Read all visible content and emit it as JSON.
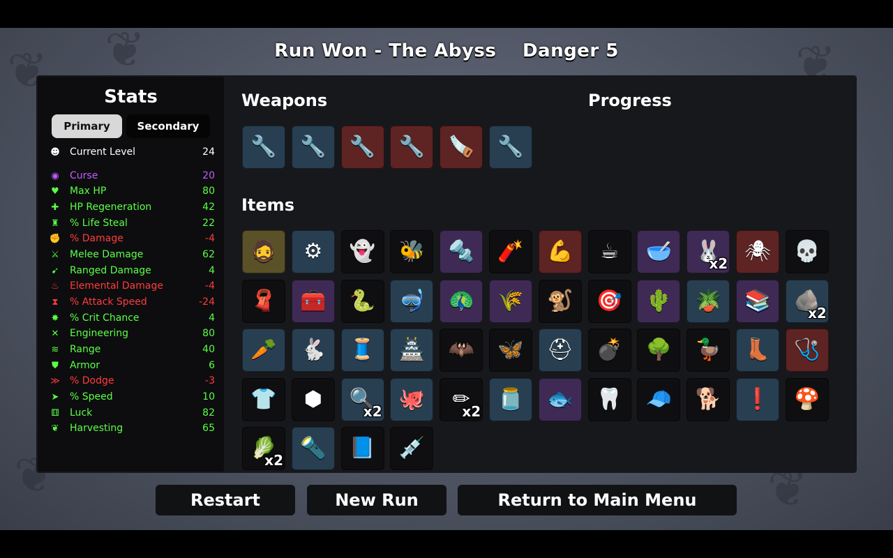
{
  "header": {
    "run_result": "Run Won - The Abyss",
    "danger": "Danger 5"
  },
  "stats": {
    "title": "Stats",
    "tabs": {
      "primary": "Primary",
      "secondary": "Secondary"
    },
    "rows": [
      {
        "label": "Current Level",
        "value": "24",
        "color": "#ffffff",
        "icon": "level-icon"
      },
      {
        "label": "Curse",
        "value": "20",
        "color": "#c35cff",
        "icon": "curse-icon"
      },
      {
        "label": "Max HP",
        "value": "80",
        "color": "#5bff46",
        "icon": "heart-icon"
      },
      {
        "label": "HP Regeneration",
        "value": "42",
        "color": "#5bff46",
        "icon": "regen-icon"
      },
      {
        "label": "% Life Steal",
        "value": "22",
        "color": "#5bff46",
        "icon": "life-steal-icon"
      },
      {
        "label": "% Damage",
        "value": "-4",
        "color": "#ff3c3c",
        "icon": "damage-icon"
      },
      {
        "label": "Melee Damage",
        "value": "62",
        "color": "#5bff46",
        "icon": "melee-icon"
      },
      {
        "label": "Ranged Damage",
        "value": "4",
        "color": "#5bff46",
        "icon": "ranged-icon"
      },
      {
        "label": "Elemental Damage",
        "value": "-4",
        "color": "#ff3c3c",
        "icon": "fire-icon"
      },
      {
        "label": "% Attack Speed",
        "value": "-24",
        "color": "#ff3c3c",
        "icon": "hourglass-icon"
      },
      {
        "label": "% Crit Chance",
        "value": "4",
        "color": "#5bff46",
        "icon": "crit-icon"
      },
      {
        "label": "Engineering",
        "value": "80",
        "color": "#5bff46",
        "icon": "engineering-icon"
      },
      {
        "label": "Range",
        "value": "40",
        "color": "#5bff46",
        "icon": "range-icon"
      },
      {
        "label": "Armor",
        "value": "6",
        "color": "#5bff46",
        "icon": "shield-icon"
      },
      {
        "label": "% Dodge",
        "value": "-3",
        "color": "#ff3c3c",
        "icon": "dodge-icon"
      },
      {
        "label": "% Speed",
        "value": "10",
        "color": "#5bff46",
        "icon": "speed-icon"
      },
      {
        "label": "Luck",
        "value": "82",
        "color": "#5bff46",
        "icon": "dice-icon"
      },
      {
        "label": "Harvesting",
        "value": "65",
        "color": "#5bff46",
        "icon": "harvest-icon"
      }
    ]
  },
  "sections": {
    "weapons": "Weapons",
    "progress": "Progress",
    "items": "Items"
  },
  "weapons": [
    {
      "icon": "wrench-icon",
      "tier": "blue"
    },
    {
      "icon": "wrench-icon",
      "tier": "blue"
    },
    {
      "icon": "wrench-icon",
      "tier": "red"
    },
    {
      "icon": "wrench-icon",
      "tier": "red"
    },
    {
      "icon": "chainsaw-icon",
      "tier": "red"
    },
    {
      "icon": "wrench-icon",
      "tier": "blue"
    }
  ],
  "items": [
    {
      "icon": "bearded-face-icon",
      "tier": "gold"
    },
    {
      "icon": "gear-ring-icon",
      "tier": "blue"
    },
    {
      "icon": "ghost-icon",
      "tier": "common"
    },
    {
      "icon": "bee-icon",
      "tier": "common"
    },
    {
      "icon": "screw-icon",
      "tier": "purple"
    },
    {
      "icon": "dynamite-icon",
      "tier": "common"
    },
    {
      "icon": "arm-icon",
      "tier": "red"
    },
    {
      "icon": "coffee-icon",
      "tier": "common"
    },
    {
      "icon": "mortar-icon",
      "tier": "purple"
    },
    {
      "icon": "rabbit-head-icon",
      "tier": "purple",
      "count": "x2"
    },
    {
      "icon": "spider-icon",
      "tier": "red"
    },
    {
      "icon": "skull-icon",
      "tier": "common"
    },
    {
      "icon": "red-hood-icon",
      "tier": "common"
    },
    {
      "icon": "toolbox-icon",
      "tier": "purple"
    },
    {
      "icon": "snake-icon",
      "tier": "common"
    },
    {
      "icon": "diving-helmet-icon",
      "tier": "blue"
    },
    {
      "icon": "peacock-icon",
      "tier": "purple"
    },
    {
      "icon": "wheat-icon",
      "tier": "purple"
    },
    {
      "icon": "monkey-icon",
      "tier": "common"
    },
    {
      "icon": "target-turret-icon",
      "tier": "common"
    },
    {
      "icon": "cactus-creature-icon",
      "tier": "purple"
    },
    {
      "icon": "garden-icon",
      "tier": "blue"
    },
    {
      "icon": "books-icon",
      "tier": "purple"
    },
    {
      "icon": "stone-icon",
      "tier": "blue",
      "count": "x2"
    },
    {
      "icon": "carrot-icon",
      "tier": "blue"
    },
    {
      "icon": "rabbit-icon",
      "tier": "blue"
    },
    {
      "icon": "sewing-machine-icon",
      "tier": "blue"
    },
    {
      "icon": "bunker-icon",
      "tier": "blue"
    },
    {
      "icon": "bat-icon",
      "tier": "common"
    },
    {
      "icon": "butterfly-icon",
      "tier": "common"
    },
    {
      "icon": "medic-turret-icon",
      "tier": "blue"
    },
    {
      "icon": "mine-icon",
      "tier": "common"
    },
    {
      "icon": "tree-icon",
      "tier": "common"
    },
    {
      "icon": "duck-icon",
      "tier": "common"
    },
    {
      "icon": "boot-icon",
      "tier": "blue"
    },
    {
      "icon": "medkit-icon",
      "tier": "red"
    },
    {
      "icon": "plaid-shirt-icon",
      "tier": "common"
    },
    {
      "icon": "rock-icon",
      "tier": "common"
    },
    {
      "icon": "magnifier-icon",
      "tier": "blue",
      "count": "x2"
    },
    {
      "icon": "octopus-icon",
      "tier": "blue"
    },
    {
      "icon": "pencil-icon",
      "tier": "common",
      "count": "x2"
    },
    {
      "icon": "jar-icon",
      "tier": "blue"
    },
    {
      "icon": "fish-icon",
      "tier": "purple"
    },
    {
      "icon": "tooth-icon",
      "tier": "common"
    },
    {
      "icon": "propeller-hat-icon",
      "tier": "common"
    },
    {
      "icon": "dog-icon",
      "tier": "common"
    },
    {
      "icon": "alert-creature-icon",
      "tier": "blue"
    },
    {
      "icon": "mushroom-icon",
      "tier": "common"
    },
    {
      "icon": "moss-bag-icon",
      "tier": "common",
      "count": "x2"
    },
    {
      "icon": "lamp-icon",
      "tier": "blue"
    },
    {
      "icon": "book-icon",
      "tier": "common"
    },
    {
      "icon": "syringe-icon",
      "tier": "common"
    }
  ],
  "buttons": {
    "restart": "Restart",
    "new_run": "New Run",
    "main_menu": "Return to Main Menu"
  }
}
